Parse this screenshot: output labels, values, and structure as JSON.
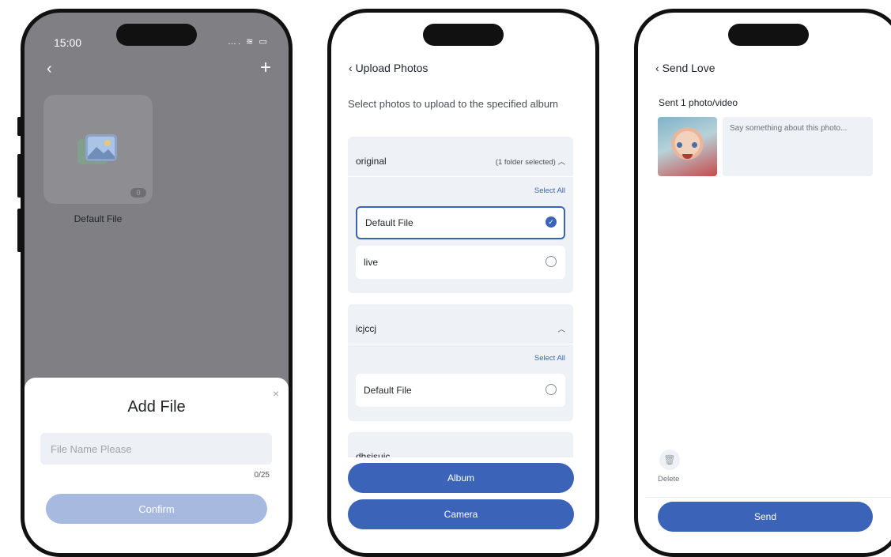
{
  "phone1": {
    "status_time": "15:00",
    "status_icons": "…. ≋ ▭",
    "back_icon": "chevron-left",
    "add_icon": "plus",
    "album": {
      "name": "Default File",
      "count": "0"
    },
    "sheet": {
      "title": "Add File",
      "close_icon": "×",
      "input_placeholder": "File Name Please",
      "counter": "0/25",
      "confirm_label": "Confirm"
    }
  },
  "phone2": {
    "title": "Upload Photos",
    "subtitle": "Select photos to upload to the specified album",
    "sections": [
      {
        "name": "original",
        "meta": "(1 folder selected)",
        "chevron": "︿",
        "select_all": "Select All",
        "options": [
          {
            "label": "Default File",
            "selected": true
          },
          {
            "label": "live",
            "selected": false
          }
        ]
      },
      {
        "name": "icjccj",
        "meta": "",
        "chevron": "︿",
        "select_all": "Select All",
        "options": [
          {
            "label": "Default File",
            "selected": false
          }
        ]
      },
      {
        "name": "dhsjsuic",
        "meta": "",
        "chevron": "︿"
      }
    ],
    "album_button": "Album",
    "camera_button": "Camera"
  },
  "phone3": {
    "title": "Send Love",
    "sent_label": "Sent 1 photo/video",
    "caption_placeholder": "Say something about this photo...",
    "delete_label": "Delete",
    "send_button": "Send"
  },
  "colors": {
    "accent": "#3b64b8",
    "accent_disabled": "#a8b9e0",
    "panel": "#eef1f6",
    "overlay": "#7f7f84"
  }
}
